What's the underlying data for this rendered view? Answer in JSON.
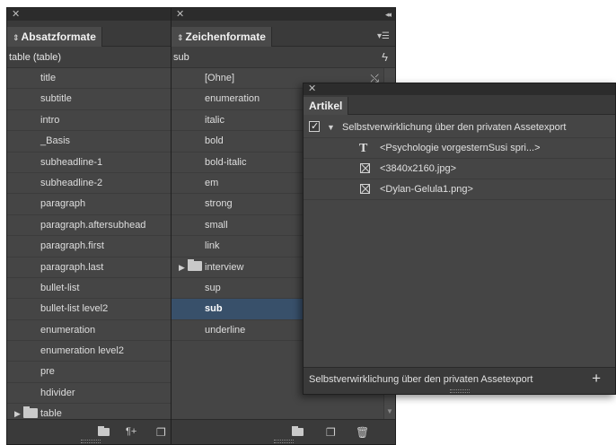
{
  "absatz": {
    "tab_label": "Absatzformate",
    "current_style": "table (table)",
    "items": [
      "title",
      "subtitle",
      "intro",
      "_Basis",
      "subheadline-1",
      "subheadline-2",
      "paragraph",
      "paragraph.aftersubhead",
      "paragraph.first",
      "paragraph.last",
      "bullet-list",
      "bullet-list level2",
      "enumeration",
      "enumeration level2",
      "pre",
      "hdivider"
    ],
    "group": "table",
    "footer_icons": [
      "folder-icon",
      "clear-overrides-icon",
      "new-style-icon"
    ]
  },
  "zeichen": {
    "tab_label": "Zeichenformate",
    "current_style": "sub",
    "items": [
      "[Ohne]",
      "enumeration",
      "italic",
      "bold",
      "bold-italic",
      "em",
      "strong",
      "small",
      "link"
    ],
    "group": "interview",
    "items_after": [
      "sup",
      "sub",
      "underline"
    ],
    "selected": "sub",
    "footer_icons": [
      "folder-icon",
      "new-style-icon",
      "trash-icon"
    ]
  },
  "artikel": {
    "tab_label": "Artikel",
    "article_title": "Selbstverwirklichung über den privaten Assetexport",
    "entries": [
      {
        "icon": "text-frame-icon",
        "label": "<Psychologie vorgesternSusi spri...>"
      },
      {
        "icon": "image-frame-icon",
        "label": "<3840x2160.jpg>"
      },
      {
        "icon": "image-frame-icon",
        "label": "<Dylan-Gelula1.png>"
      }
    ],
    "status_text": "Selbstverwirklichung über den privaten Assetexport",
    "add_label": "+"
  },
  "colors": {
    "panel_bg": "#454545",
    "topbar_bg": "#2c2c2c",
    "selection": "#38506a"
  }
}
